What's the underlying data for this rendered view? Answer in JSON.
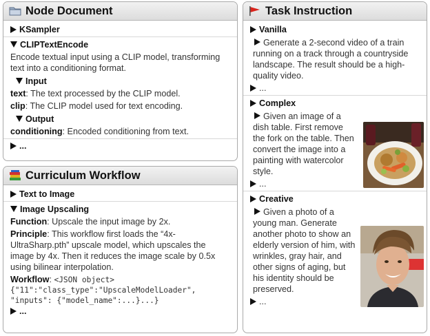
{
  "node_document": {
    "title": "Node Document",
    "ksampler": "KSampler",
    "clip": "CLIPTextEncode",
    "clip_desc": "Encode textual input using a CLIP model, transforming text into a conditioning format.",
    "input_label": "Input",
    "text_key": "text",
    "text_desc": ": The text processed by the CLIP model.",
    "clip_key": "clip",
    "clip_key_desc": ": The CLIP model used for text encoding.",
    "output_label": "Output",
    "cond_key": "conditioning",
    "cond_desc": ": Encoded conditioning from text.",
    "more": "..."
  },
  "curriculum": {
    "title": "Curriculum Workflow",
    "text_to_image": "Text to Image",
    "image_upscaling": "Image Upscaling",
    "function_key": "Function",
    "function_desc": ": Upscale the input image by 2x.",
    "principle_key": "Principle",
    "principle_desc": ": This workflow first loads the “4x-UltraSharp.pth” upscale model, which upscales the image by 4x. Then it reduces the image scale by 0.5x using bilinear interpolation.",
    "workflow_key": "Workflow",
    "workflow_json": "<JSON object>",
    "json_line1": "{\"11\":\"class_type\":\"UpscaleModelLoader\",",
    "json_line2": "\"inputs\": {\"model_name\":...}...}",
    "more": "..."
  },
  "task": {
    "title": "Task Instruction",
    "vanilla": "Vanilla",
    "vanilla_text": "Generate a 2-second video of a train running on a track through a countryside landscape. The result should be a high-quality video.",
    "complex": "Complex",
    "complex_text": "Given an image of a dish table. First remove the fork on the table. Then convert the image into a painting with watercolor style.",
    "creative": "Creative",
    "creative_text": "Given a photo of a young man. Generate another photo to show an elderly version of him, with wrinkles, gray hair, and other signs of aging, but his identity should be preserved.",
    "more": "..."
  },
  "colors": {
    "header_bg": "#e3e3e3",
    "border": "#a9a9a9",
    "flag": "#d9241c"
  }
}
